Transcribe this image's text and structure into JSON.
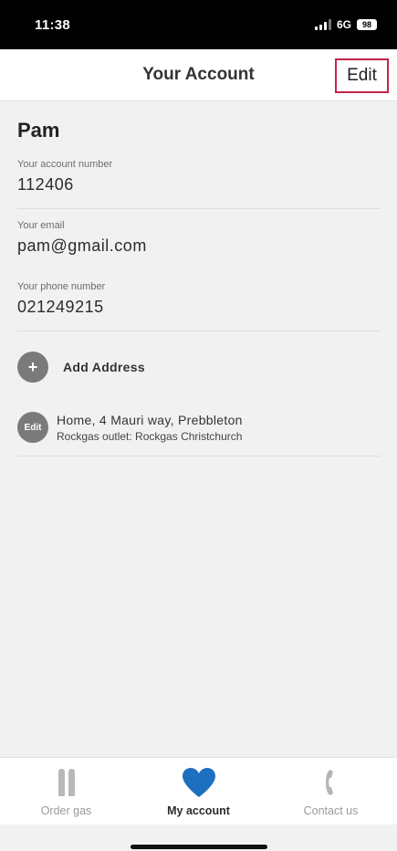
{
  "status_bar": {
    "time": "11:38",
    "network": "6G",
    "battery": "98"
  },
  "header": {
    "title": "Your Account",
    "edit_label": "Edit"
  },
  "account": {
    "name": "Pam",
    "fields": [
      {
        "label": "Your account number",
        "value": "112406"
      },
      {
        "label": "Your email",
        "value": "pam@gmail.com"
      },
      {
        "label": "Your phone number",
        "value": "021249215"
      }
    ]
  },
  "add_address": {
    "icon_text": "+",
    "label": "Add Address"
  },
  "addresses": [
    {
      "edit_label": "Edit",
      "address": "Home, 4 Mauri way, Prebbleton",
      "outlet": "Rockgas outlet: Rockgas Christchurch"
    }
  ],
  "tabs": [
    {
      "label": "Order gas",
      "icon": "gas-bottle-icon",
      "active": false
    },
    {
      "label": "My account",
      "icon": "heart-icon",
      "active": true
    },
    {
      "label": "Contact us",
      "icon": "phone-icon",
      "active": false
    }
  ],
  "colors": {
    "accent_blue": "#1f6fc0",
    "edit_border": "#c4244a",
    "background": "#f1f1f1"
  }
}
